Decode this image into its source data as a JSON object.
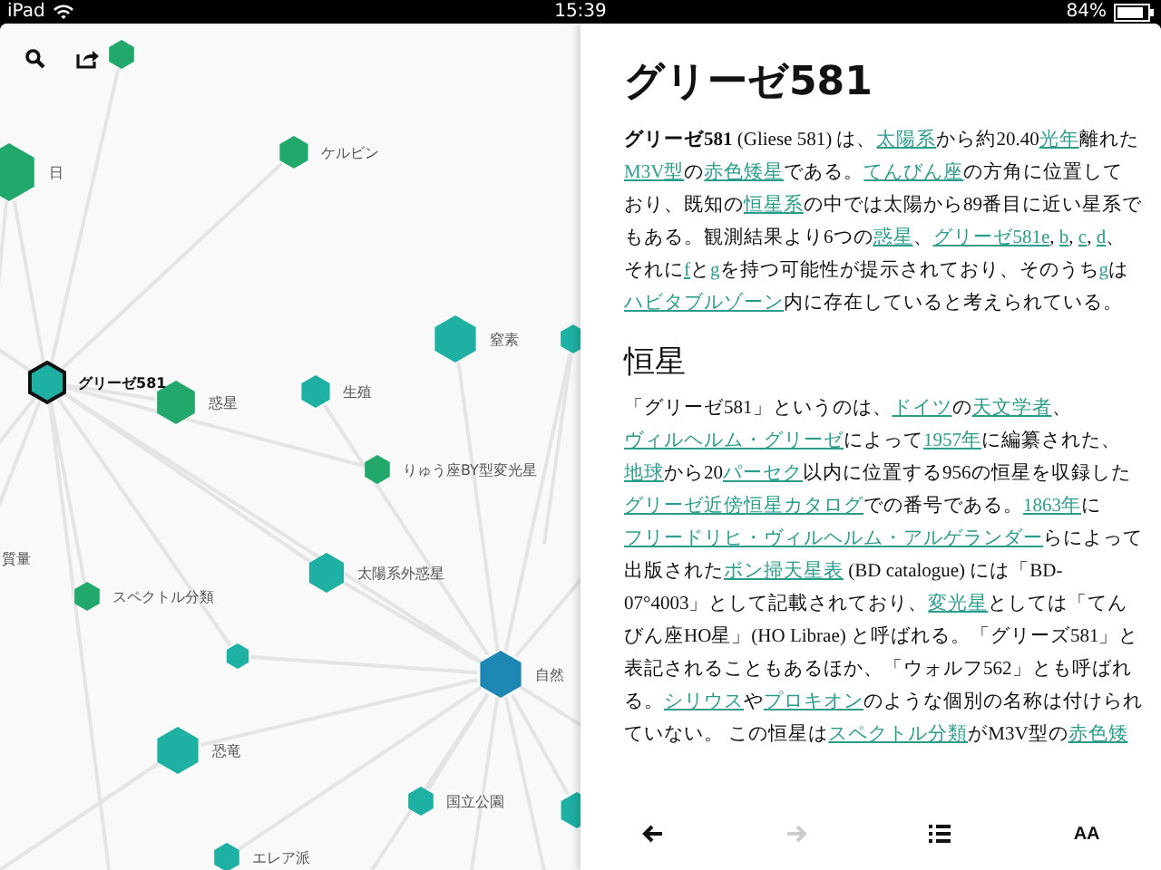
{
  "status_bar": {
    "device": "iPad",
    "time": "15:39",
    "battery": "84%"
  },
  "graph": {
    "nodes": [
      {
        "color": "#22a86a",
        "selected": false
      },
      {
        "label": "日",
        "color": "#22a86a",
        "selected": false
      },
      {
        "label": "ケルビン",
        "color": "#22a86a",
        "selected": false
      },
      {
        "label": "窒素",
        "color": "#1eb0a2",
        "selected": false
      },
      {
        "color": "#1eb0a2",
        "selected": false
      },
      {
        "label": "グリーゼ581",
        "color": "#1eb0a2",
        "selected": true
      },
      {
        "label": "惑星",
        "color": "#22a86a",
        "selected": false
      },
      {
        "label": "生殖",
        "color": "#1eb0a2",
        "selected": false
      },
      {
        "label": "りゅう座BY型変光星",
        "color": "#22a86a",
        "selected": false
      },
      {
        "label": "スペクトル分類",
        "color": "#22a86a",
        "selected": false
      },
      {
        "label": "太陽系外惑星",
        "color": "#1eb0a2",
        "selected": false
      },
      {
        "color": "#1eb0a2",
        "selected": false
      },
      {
        "label": "自然",
        "color": "#1f87b3",
        "selected": false
      },
      {
        "label": "恐竜",
        "color": "#1eb0a2",
        "selected": false
      },
      {
        "label": "国立公園",
        "color": "#1eb0a2",
        "selected": false
      },
      {
        "label": "エレア派",
        "color": "#1eb0a2",
        "selected": false
      },
      {
        "color": "#1eb0a2",
        "selected": false
      }
    ],
    "edge_labels": [
      "質量"
    ]
  },
  "article": {
    "title": "グリーゼ581",
    "sections": [
      {
        "segments": [
          {
            "text": "**グリーゼ581** (Gliese 581) は、",
            "link": false
          },
          {
            "text": "太陽系",
            "link": true
          },
          {
            "text": "から約20.40",
            "link": false
          },
          {
            "text": "光年",
            "link": true
          },
          {
            "text": "離れた",
            "link": false
          },
          {
            "text": "M3V型",
            "link": true
          },
          {
            "text": "の",
            "link": false
          },
          {
            "text": "赤色矮星",
            "link": true
          },
          {
            "text": "である。",
            "link": false
          },
          {
            "text": "てんびん座",
            "link": true
          },
          {
            "text": "の方角に位置しており、既知の",
            "link": false
          },
          {
            "text": "恒星系",
            "link": true
          },
          {
            "text": "の中では太陽から89番目に近い星系でもある。観測結果より6つの",
            "link": false
          },
          {
            "text": "惑星",
            "link": true
          },
          {
            "text": "、",
            "link": false
          },
          {
            "text": "グリーゼ581e",
            "link": true
          },
          {
            "text": ", ",
            "link": false
          },
          {
            "text": "b",
            "link": true
          },
          {
            "text": ", ",
            "link": false
          },
          {
            "text": "c",
            "link": true
          },
          {
            "text": ", ",
            "link": false
          },
          {
            "text": "d",
            "link": true
          },
          {
            "text": "、それに",
            "link": false
          },
          {
            "text": "f",
            "link": true
          },
          {
            "text": "と",
            "link": false
          },
          {
            "text": "g",
            "link": true
          },
          {
            "text": "を持つ可能性が提示されており、そのうち",
            "link": false
          },
          {
            "text": "g",
            "link": true
          },
          {
            "text": "は",
            "link": false
          },
          {
            "text": "ハビタブルゾーン",
            "link": true
          },
          {
            "text": "内に存在していると考えられている。",
            "link": false
          }
        ]
      },
      {
        "heading": "恒星",
        "segments": [
          {
            "text": "「グリーゼ581」というのは、",
            "link": false
          },
          {
            "text": "ドイツ",
            "link": true
          },
          {
            "text": "の",
            "link": false
          },
          {
            "text": "天文学者",
            "link": true
          },
          {
            "text": "、",
            "link": false
          },
          {
            "text": "ヴィルヘルム・グリーゼ",
            "link": true
          },
          {
            "text": "によって",
            "link": false
          },
          {
            "text": "1957年",
            "link": true
          },
          {
            "text": "に編纂された、",
            "link": false
          },
          {
            "text": "地球",
            "link": true
          },
          {
            "text": "から20",
            "link": false
          },
          {
            "text": "パーセク",
            "link": true
          },
          {
            "text": "以内に位置する956の恒星を収録した",
            "link": false
          },
          {
            "text": "グリーゼ近傍恒星カタログ",
            "link": true
          },
          {
            "text": "での番号である。",
            "link": false
          },
          {
            "text": "1863年",
            "link": true
          },
          {
            "text": "に",
            "link": false
          },
          {
            "text": "フリードリヒ・ヴィルヘルム・アルゲランダー",
            "link": true
          },
          {
            "text": "らによって出版された",
            "link": false
          },
          {
            "text": "ボン掃天星表",
            "link": true
          },
          {
            "text": " (BD catalogue) には「BD-07°4003」として記載されており、",
            "link": false
          },
          {
            "text": "変光星",
            "link": true
          },
          {
            "text": "としては「てんびん座HO星」(HO Librae) と呼ばれる。「グリーズ581」と表記されることもあるほか、「ウォルフ562」とも呼ばれる。",
            "link": false
          },
          {
            "text": "シリウス",
            "link": true
          },
          {
            "text": "や",
            "link": false
          },
          {
            "text": "プロキオン",
            "link": true
          },
          {
            "text": "のような個別の名称は付けられていない。 この恒星は",
            "link": false
          },
          {
            "text": "スペクトル分類",
            "link": true
          },
          {
            "text": "がM3V型の",
            "link": false
          },
          {
            "text": "赤色矮",
            "link": true
          }
        ]
      }
    ]
  },
  "toolbar": {
    "back_disabled": false,
    "forward_disabled": true,
    "font_label": "AA"
  }
}
